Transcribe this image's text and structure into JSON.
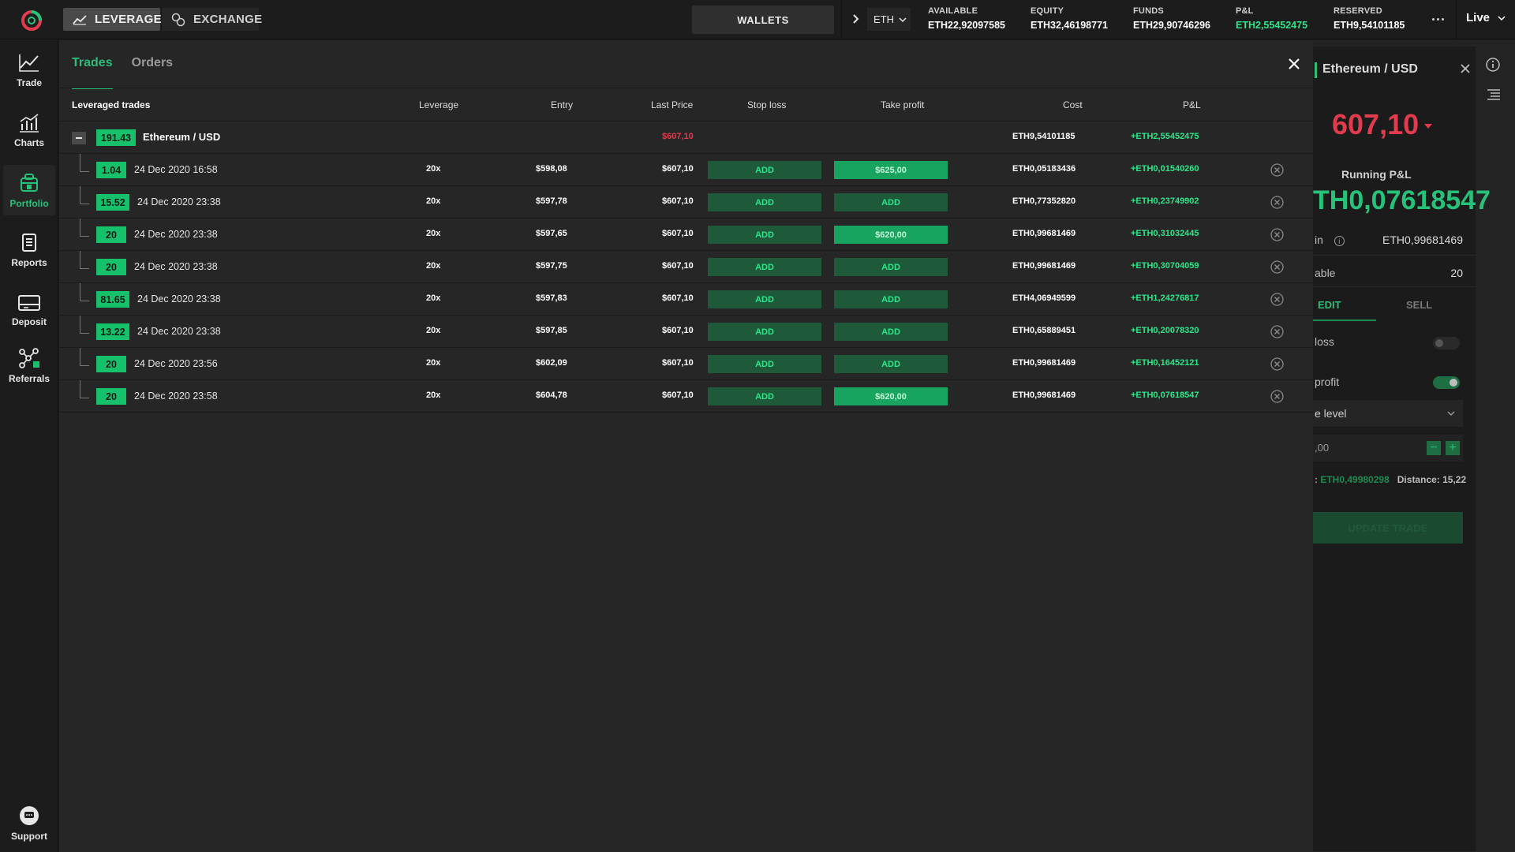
{
  "topbar": {
    "modes": [
      {
        "label": "LEVERAGE",
        "icon": "chart-line-icon",
        "active": true
      },
      {
        "label": "EXCHANGE",
        "icon": "exchange-icon",
        "active": false
      }
    ],
    "wallets_label": "WALLETS",
    "currency": "ETH",
    "stats": [
      {
        "label": "AVAILABLE",
        "value": "ETH22,92097585"
      },
      {
        "label": "EQUITY",
        "value": "ETH32,46198771"
      },
      {
        "label": "FUNDS",
        "value": "ETH29,90746296"
      },
      {
        "label": "P&L",
        "value": "ETH2,55452475"
      },
      {
        "label": "RESERVED",
        "value": "ETH9,54101185"
      }
    ],
    "live_label": "Live"
  },
  "sidebar": {
    "items": [
      {
        "label": "Trade",
        "icon": "trade-icon"
      },
      {
        "label": "Charts",
        "icon": "charts-icon"
      },
      {
        "label": "Portfolio",
        "icon": "portfolio-icon",
        "active": true
      },
      {
        "label": "Reports",
        "icon": "reports-icon"
      },
      {
        "label": "Deposit",
        "icon": "deposit-icon"
      },
      {
        "label": "Referrals",
        "icon": "referrals-icon"
      }
    ],
    "support_label": "Support"
  },
  "colors": {
    "accent": "#27c27a",
    "badge": "#17c06a",
    "negative": "#e23b4d",
    "add_button": "#1e5a3a",
    "take_profit_set": "#18a35f"
  },
  "panel": {
    "tabs": [
      {
        "label": "Trades",
        "active": true
      },
      {
        "label": "Orders",
        "active": false
      }
    ],
    "headers": {
      "title": "Leveraged trades",
      "leverage": "Leverage",
      "entry": "Entry",
      "last_price": "Last Price",
      "stop_loss": "Stop loss",
      "take_profit": "Take profit",
      "cost": "Cost",
      "pnl": "P&L"
    },
    "group": {
      "amount": "191.43",
      "pair": "Ethereum / USD",
      "last_price": "$607,10",
      "cost": "ETH9,54101185",
      "pnl": "+ETH2,55452475"
    },
    "trades": [
      {
        "amount": "1.04",
        "date": "24 Dec 2020 16:58",
        "leverage": "20x",
        "entry": "$598,08",
        "last_price": "$607,10",
        "stop_loss": "ADD",
        "take_profit": "$625,00",
        "tp_set": true,
        "cost": "ETH0,05183436",
        "pnl": "+ETH0,01540260"
      },
      {
        "amount": "15.52",
        "date": "24 Dec 2020 23:38",
        "leverage": "20x",
        "entry": "$597,78",
        "last_price": "$607,10",
        "stop_loss": "ADD",
        "take_profit": "ADD",
        "tp_set": false,
        "cost": "ETH0,77352820",
        "pnl": "+ETH0,23749902"
      },
      {
        "amount": "20",
        "date": "24 Dec 2020 23:38",
        "leverage": "20x",
        "entry": "$597,65",
        "last_price": "$607,10",
        "stop_loss": "ADD",
        "take_profit": "$620,00",
        "tp_set": true,
        "cost": "ETH0,99681469",
        "pnl": "+ETH0,31032445"
      },
      {
        "amount": "20",
        "date": "24 Dec 2020 23:38",
        "leverage": "20x",
        "entry": "$597,75",
        "last_price": "$607,10",
        "stop_loss": "ADD",
        "take_profit": "ADD",
        "tp_set": false,
        "cost": "ETH0,99681469",
        "pnl": "+ETH0,30704059"
      },
      {
        "amount": "81.65",
        "date": "24 Dec 2020 23:38",
        "leverage": "20x",
        "entry": "$597,83",
        "last_price": "$607,10",
        "stop_loss": "ADD",
        "take_profit": "ADD",
        "tp_set": false,
        "cost": "ETH4,06949599",
        "pnl": "+ETH1,24276817"
      },
      {
        "amount": "13.22",
        "date": "24 Dec 2020 23:38",
        "leverage": "20x",
        "entry": "$597,85",
        "last_price": "$607,10",
        "stop_loss": "ADD",
        "take_profit": "ADD",
        "tp_set": false,
        "cost": "ETH0,65889451",
        "pnl": "+ETH0,20078320"
      },
      {
        "amount": "20",
        "date": "24 Dec 2020 23:56",
        "leverage": "20x",
        "entry": "$602,09",
        "last_price": "$607,10",
        "stop_loss": "ADD",
        "take_profit": "ADD",
        "tp_set": false,
        "cost": "ETH0,99681469",
        "pnl": "+ETH0,16452121"
      },
      {
        "amount": "20",
        "date": "24 Dec 2020 23:58",
        "leverage": "20x",
        "entry": "$604,78",
        "last_price": "$607,10",
        "stop_loss": "ADD",
        "take_profit": "$620,00",
        "tp_set": true,
        "cost": "ETH0,99681469",
        "pnl": "+ETH0,07618547"
      }
    ]
  },
  "side_panel": {
    "title": "Ethereum / USD",
    "price": "607,10",
    "running_label": "Running P&L",
    "running_value": "TH0,07618547",
    "margin_label": "in",
    "margin_value": "ETH0,99681469",
    "leverage_label": "able",
    "leverage_value": "20",
    "tab_edit": "EDIT",
    "tab_sell": "SELL",
    "stop_loss_label": "loss",
    "take_profit_label": "profit",
    "level_label": "e level",
    "input_value": ",00",
    "margin_info_prefix": ":",
    "margin_info_value": "ETH0,49980298",
    "distance": "Distance: 15,22",
    "update_label": "UPDATE TRADE"
  }
}
